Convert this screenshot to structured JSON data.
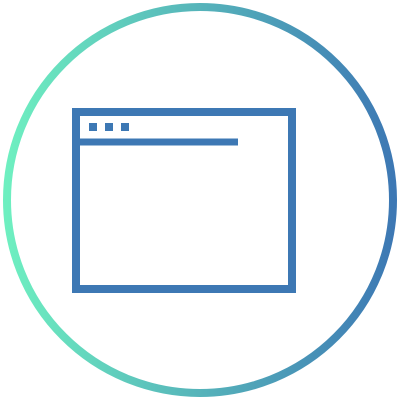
{
  "icon": {
    "name": "browser-window-icon",
    "frame": "gradient-ring-icon"
  },
  "colors": {
    "ring_gradient_start": "#6EEFC0",
    "ring_gradient_end": "#3D78B4",
    "window_stroke": "#3D78B4",
    "background": "#FFFFFF"
  }
}
